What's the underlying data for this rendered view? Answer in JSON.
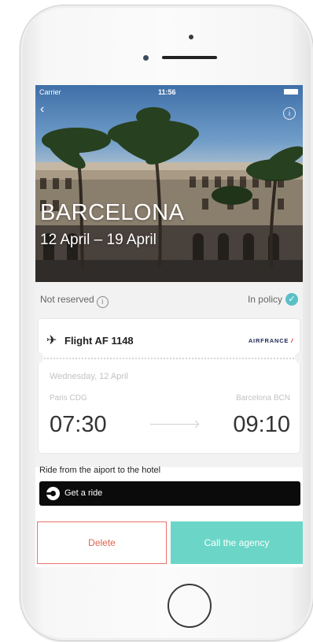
{
  "status_bar": {
    "carrier": "Carrier",
    "time": "11:56"
  },
  "hero": {
    "city": "BARCELONA",
    "dates": "12 April – 19 April"
  },
  "reservation": {
    "status": "Not reserved",
    "policy": "In policy"
  },
  "flight": {
    "title": "Flight AF 1148",
    "airline_logo": "AIRFRANCE",
    "date": "Wednesday, 12 April",
    "origin": "Paris CDG",
    "destination": "Barcelona BCN",
    "departure_time": "07:30",
    "arrival_time": "09:10"
  },
  "ride": {
    "label": "Ride from the aiport to the hotel",
    "button": "Get a ride"
  },
  "actions": {
    "delete": "Delete",
    "call": "Call the agency"
  },
  "colors": {
    "accent_teal": "#6bd6c7",
    "delete_red": "#e0624f",
    "policy_check": "#5bc0c5"
  },
  "icons": {
    "back": "chevron-left-icon",
    "info": "info-icon",
    "plane": "plane-icon",
    "check": "check-icon",
    "ride": "ride-logo-icon"
  }
}
